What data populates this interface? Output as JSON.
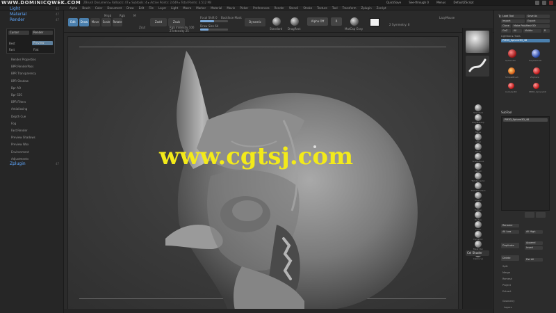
{
  "titlebar": {
    "brand": "WWW.DOMINICQWEK.COM",
    "info": "ZBrush Document   ▸ Fallback: 47  ▸ Subtools: 4  ▸ Active Points: 2,649  ▸ Total Points: 3.512 Mil",
    "right_items": [
      "QuickSave",
      "See-through 0",
      "Menus",
      "DefaultZScript"
    ]
  },
  "menubar": {
    "items": [
      "Alpha",
      "Brush",
      "Color",
      "Document",
      "Draw",
      "Edit",
      "File",
      "Layer",
      "Light",
      "Macro",
      "Marker",
      "Material",
      "Movie",
      "Picker",
      "Preferences",
      "Render",
      "Stencil",
      "Stroke",
      "Texture",
      "Tool",
      "Transform",
      "Zplugin",
      "Zscript"
    ]
  },
  "leftpanel": {
    "items": [
      {
        "label": "Light",
        "count": "42"
      },
      {
        "label": "Material",
        "count": "47"
      },
      {
        "label": "Render",
        "count": "47"
      }
    ],
    "popup": {
      "btn1": "Cursor",
      "btn2": "Render",
      "row2_left": "Best",
      "row2_right": "Preview",
      "row3_left": "Fast",
      "row3_right": "Flat"
    },
    "sub_items": [
      "Render Properties",
      "BPR RenderPass",
      "BPR Transparency",
      "BPR Shadow",
      "Bpr AO",
      "Bpr SSS",
      "BPR Filters",
      "Antialiasing",
      "Depth Cue",
      "Fog",
      "Fast Render",
      "Preview Shadows",
      "Preview Wax",
      "Environment",
      "Adjustments"
    ],
    "last_item": {
      "label": "Zplugin",
      "count": "47"
    }
  },
  "toolbar": {
    "edit": "Edit",
    "draw": "Draw",
    "move": "Move",
    "scale": "Scale",
    "rotate": "Rotate",
    "mrgb": "Mrgb",
    "rgb": "Rgb",
    "m": "M",
    "zadd": "Zadd",
    "zsub": "Zsub",
    "zcut": "Zcut",
    "focal": "Focal Shift 0",
    "draw_size": "Draw Size 64",
    "rgb_intensity": "Rgb Intensity 100",
    "z_intensity": "Z Intensity 25",
    "backface": "Backface Mask",
    "fmask": "Dynamic",
    "brush_label": "Standard",
    "stroke_label": "DragRect",
    "alpha_label": "Alpha Off",
    "texture_label": "Texture Off",
    "material_label": "MatCap Gray",
    "poly_label": "Polypaint",
    "symmetry": "2 Symmetry: 8",
    "r_label": "R",
    "lazy": "LazyMouse",
    "intensity_value": 0.25
  },
  "shelf": {
    "brushes": [
      "Standard",
      "ClayBuildup",
      "Move",
      "Inflat",
      "Pinch",
      "SnakeHook",
      "hPolish",
      "TrimDynamic",
      "DamStandard",
      "Slash2",
      "Flatten",
      "Nudge",
      "Layer",
      "Dynamic",
      "Mask Pen",
      "ClipCurve"
    ],
    "bottom_btn": "Cel Shader"
  },
  "tray": {
    "title": "Tool",
    "load": "Load Tool",
    "save": "Save As",
    "import": "Import",
    "export": "Export",
    "clone": "Clone",
    "make_poly": "Make PolyMesh3D",
    "goz": "GoZ",
    "all": "All",
    "visible": "Visible",
    "r": "R",
    "lightbox": "Lightbox ▸ Tools",
    "current_tool": "PM3D_Sphere3D_48",
    "tools": [
      "Sphere3D",
      "PolyMesh3D",
      "SimpleBrush",
      "ZSphere",
      "Cylinder3D",
      "PM3D_Sphere3D"
    ],
    "subtool_header": "SubTool",
    "subtool_name": "PM3D_Sphere3D_48",
    "list_items": [
      "Rename",
      "AutoReorder",
      "All Low",
      "All High"
    ],
    "dup": "Duplicate",
    "append": "Append",
    "insert": "Insert",
    "delete": "Delete",
    "del_other": "Del Other",
    "del_all": "Del All",
    "sections": [
      "Split",
      "Merge",
      "Remesh",
      "Project",
      "Extract"
    ],
    "bottom": [
      "Geometry",
      "Layers"
    ]
  },
  "canvas": {
    "watermark": "www.cgtsj.com"
  },
  "colors": {
    "accent_blue": "#4b80ae",
    "menu_blue": "#5fa8ff",
    "watermark": "#f3ea1a"
  }
}
